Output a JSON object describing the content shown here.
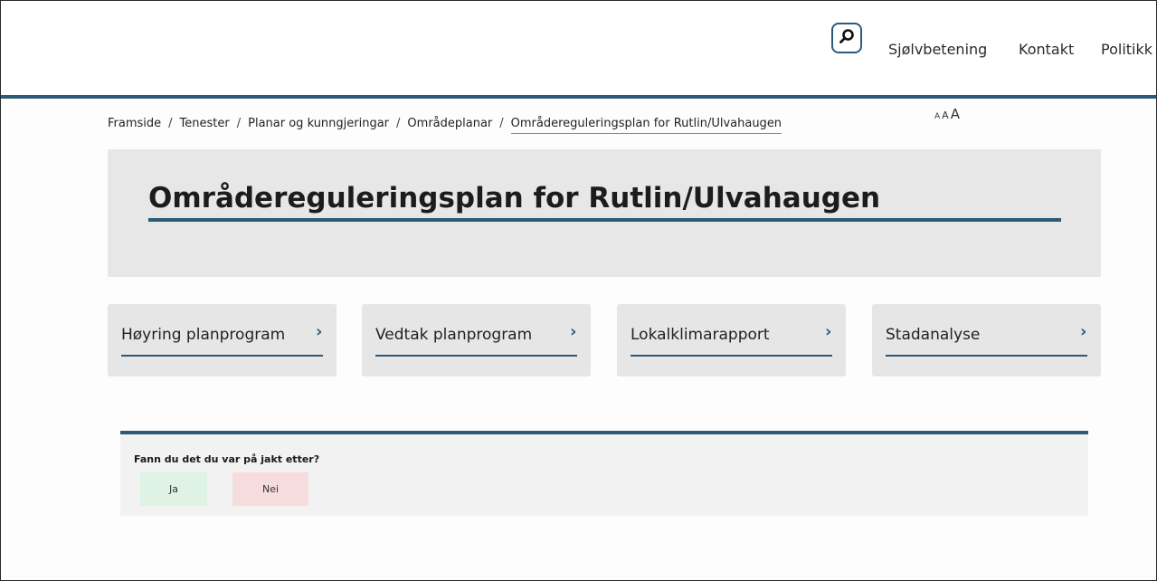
{
  "header": {
    "search_icon": "search-icon",
    "nav": [
      "Sjølvbetening",
      "Kontakt",
      "Politikk"
    ],
    "accent_color": "#2e5a78"
  },
  "breadcrumb": {
    "items": [
      "Framside",
      "Tenester",
      "Planar og kunngjeringar",
      "Områdeplanar",
      "Områdereguleringsplan for Rutlin/Ulvahaugen"
    ],
    "separator": "/"
  },
  "font_size_tool": [
    "A",
    "A",
    "A"
  ],
  "page": {
    "title": "Områdereguleringsplan for Rutlin/Ulvahaugen"
  },
  "cards": [
    {
      "label": "Høyring planprogram",
      "arrow": "›"
    },
    {
      "label": "Vedtak planprogram",
      "arrow": "›"
    },
    {
      "label": "Lokalklimarapport",
      "arrow": "›"
    },
    {
      "label": "Stadanalyse",
      "arrow": "›"
    }
  ],
  "feedback": {
    "question": "Fann du det du var på jakt etter?",
    "yes_label": "Ja",
    "no_label": "Nei",
    "yes_color": "#dff3e4",
    "no_color": "#f6dcdc"
  }
}
